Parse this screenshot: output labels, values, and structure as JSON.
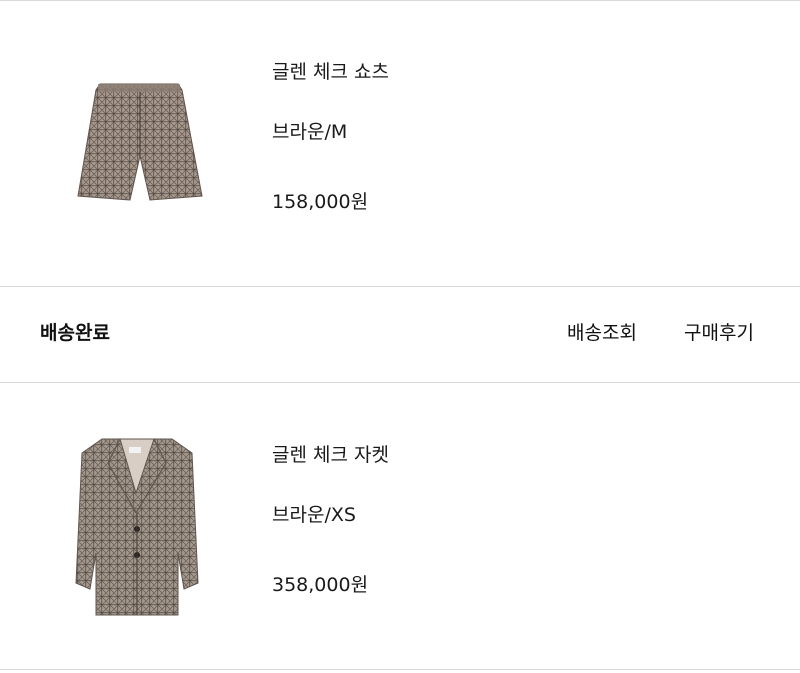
{
  "orders": [
    {
      "product_name": "글렌 체크 쇼츠",
      "option": "브라운/M",
      "price": "158,000원",
      "image_icon": "shorts-icon"
    },
    {
      "product_name": "글렌 체크 자켓",
      "option": "브라운/XS",
      "price": "358,000원",
      "image_icon": "jacket-icon"
    }
  ],
  "delivery": {
    "status": "배송완료",
    "track_label": "배송조회",
    "review_label": "구매후기"
  }
}
